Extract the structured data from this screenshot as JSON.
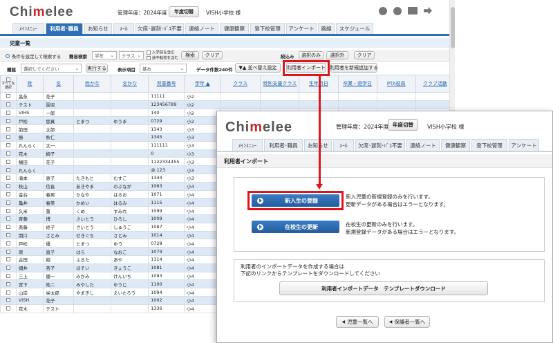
{
  "app": {
    "logo_pre": "Chi",
    "logo_mid": "m",
    "logo_post": "elee",
    "year_label": "管理年度：2024年度",
    "year_switch": "年度切替",
    "school": "VISH小学校 様"
  },
  "tabs": [
    "ﾒｲﾝﾒﾆｭｰ",
    "利用者･職員",
    "お知らせ",
    "ﾒｰﾙ",
    "欠席･遅刻･ﾊﾞｽ不要",
    "連絡ノート",
    "健康観察",
    "登下校管理",
    "アンケート",
    "路線",
    "スケジュール"
  ],
  "page_title": "児童一覧",
  "search": {
    "cond_search": "条件を設定して検索する",
    "simple_label": "簡易検索",
    "grade_ph": "学年",
    "class_ph": "クラス",
    "opt1": "入学前を含む",
    "opt2": "途中転校を含む",
    "search_btn": "検索",
    "clear_btn": "クリア",
    "narrow": "絞込み",
    "sel_only": "選択のみ",
    "sel_except": "選択外",
    "clear2": "クリア"
  },
  "func": {
    "label": "機能",
    "select_ph": "選択してください",
    "exec": "実行する",
    "display_label": "表示項目",
    "display_val": "基本",
    "count": "データ件数240件",
    "sort": "▼▲ 並べ替え設定",
    "import": "利用者インポート",
    "add_new": "利用者を新規追加する"
  },
  "table": {
    "headers": [
      "すべてを選択",
      "姓",
      "名",
      "姓かな",
      "名かな",
      "児童番号",
      "学年 ▲",
      "クラス",
      "特別支援クラス",
      "生年月日",
      "卒業・退学日",
      "PTA役員",
      "クラブ活動"
    ],
    "rows": [
      [
        "畠永",
        "花子",
        "",
        "",
        "11111",
        "小2"
      ],
      [
        "テスト",
        "園児",
        "",
        "",
        "123456789",
        "小2"
      ],
      [
        "VIHS",
        "一郎",
        "",
        "",
        "140",
        "小2"
      ],
      [
        "戸松",
        "悠真",
        "とまつ",
        "ゆうま",
        "0729",
        "小2"
      ],
      [
        "前田",
        "太郎",
        "",
        "",
        "1343",
        "小3"
      ],
      [
        "勝",
        "秋仁",
        "",
        "",
        "1345",
        "小3"
      ],
      [
        "れんらく",
        "太一",
        "",
        "",
        "111111",
        "小3"
      ],
      [
        "花木",
        "絢子",
        "",
        "",
        "0",
        "小3"
      ],
      [
        "鯛田",
        "花子",
        "",
        "",
        "1122334455",
        "小3"
      ],
      [
        "れんらく",
        "",
        "",
        "",
        "@.123",
        "小3"
      ],
      [
        "滝本",
        "恵子",
        "たきもと",
        "むすこ",
        "1344",
        "小3"
      ],
      [
        "秋山",
        "信長",
        "あきやま",
        "のぶなが",
        "1063",
        "小4"
      ],
      [
        "金谷",
        "春男",
        "かなや",
        "はるお",
        "1071",
        "小4"
      ],
      [
        "亀井",
        "春美",
        "かめい",
        "はるみ",
        "1115",
        "小4"
      ],
      [
        "久米",
        "重",
        "くめ",
        "すみれ",
        "1099",
        "小4"
      ],
      [
        "斉藤",
        "博",
        "さいとう",
        "ひろし",
        "1009",
        "小4"
      ],
      [
        "斎藤",
        "修子",
        "さいとう",
        "しゅうこ",
        "1087",
        "小4"
      ],
      [
        "関口",
        "さとみ",
        "せきぐち",
        "さとみ",
        "1014",
        "小4"
      ],
      [
        "戸松",
        "優",
        "とまつ",
        "ゆう",
        "0728",
        "小4"
      ],
      [
        "原",
        "直子",
        "はら",
        "なおこ",
        "1079",
        "小4"
      ],
      [
        "古田",
        "絢",
        "ふるた",
        "あや",
        "1114",
        "小4"
      ],
      [
        "細井",
        "杏子",
        "ほそい",
        "きょうこ",
        "1081",
        "小4"
      ],
      [
        "三上",
        "健一",
        "みかみ",
        "けんいち",
        "1093",
        "小4"
      ],
      [
        "宮下",
        "祐二",
        "みやした",
        "ゆうじ",
        "1100",
        "小4"
      ],
      [
        "山岸",
        "栄太郎",
        "やまぎし",
        "えいたろう",
        "1094",
        "小4"
      ],
      [
        "VISH",
        "花子",
        "",
        "",
        "1002",
        "小4"
      ],
      [
        "花木",
        "テスト",
        "",
        "",
        "1336",
        "小4"
      ]
    ]
  },
  "overlay": {
    "title": "利用者インポート",
    "new_btn": "新入生の登録",
    "new_desc1": "新入児童の新規登録のみを行います。",
    "new_desc2": "更新データがある場合はエラーとなります。",
    "update_btn": "在校生の更新",
    "update_desc1": "在校生の更新のみを行います。",
    "update_desc2": "新規登録データがある場合はエラーとなります。",
    "tpl_desc1": "利用者のインポートデータを作成する場合は",
    "tpl_desc2": "下記のリンクからテンプレートをダウンロードしてください",
    "tpl_btn": "利用者インポートデータ　テンプレートダウンロード",
    "back1": "児童一覧へ",
    "back2": "保護者一覧へ"
  },
  "colors": {
    "accent": "#2f6fb6",
    "highlight": "#e0141b",
    "logo_red": "#c8282a"
  }
}
